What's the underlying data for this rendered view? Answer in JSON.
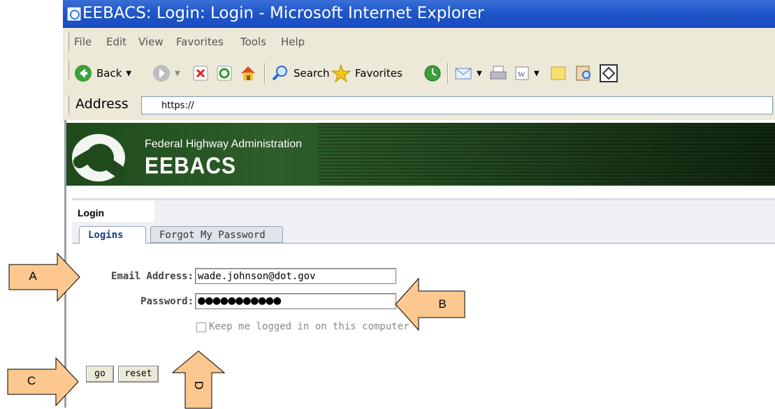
{
  "window": {
    "title": "EEBACS: Login: Login - Microsoft Internet Explorer"
  },
  "menu": [
    "File",
    "Edit",
    "View",
    "Favorites",
    "Tools",
    "Help"
  ],
  "toolbar": {
    "back_label": "Back",
    "search_label": "Search",
    "favorites_label": "Favorites"
  },
  "address": {
    "label": "Address",
    "value": "https://"
  },
  "banner": {
    "agency": "Federal Highway Administration",
    "app_name": "EEBACS"
  },
  "section": {
    "title": "Login"
  },
  "tabs": [
    {
      "label": "Logins",
      "active": true
    },
    {
      "label": "Forgot My Password",
      "active": false
    }
  ],
  "form": {
    "email_label": "Email Address:",
    "email_value": "wade.johnson@dot.gov",
    "password_label": "Password:",
    "password_value": "●●●●●●●●●●●",
    "remember_label": "Keep me logged in on this computer",
    "remember_checked": false,
    "go_label": "go",
    "reset_label": "reset"
  },
  "callouts": [
    "A",
    "B",
    "C",
    "D"
  ],
  "colors": {
    "callout_fill": "#fcc88f",
    "title_bar": "#1f56c9",
    "banner_green": "#2e5e29",
    "active_tab_text": "#1a3a8a"
  }
}
